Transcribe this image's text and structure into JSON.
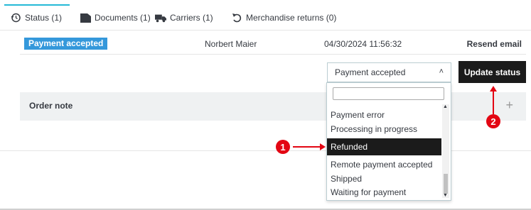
{
  "tabs": [
    {
      "label": "Status (1)",
      "icon": "history-icon",
      "active": true
    },
    {
      "label": "Documents (1)",
      "icon": "document-icon"
    },
    {
      "label": "Carriers (1)",
      "icon": "truck-icon"
    },
    {
      "label": "Merchandise returns (0)",
      "icon": "return-icon"
    }
  ],
  "history": {
    "status": "Payment accepted",
    "status_color": "#3498db",
    "employee": "Norbert Maier",
    "date": "04/30/2024 11:56:32",
    "resend": "Resend email"
  },
  "status_select": {
    "value": "Payment accepted",
    "options": [
      "Payment error",
      "Processing in progress",
      "Refunded",
      "Remote payment accepted",
      "Shipped",
      "Waiting for payment"
    ],
    "selected_option": "Refunded"
  },
  "update_button": "Update status",
  "order_note": {
    "title": "Order note",
    "add": "+"
  },
  "annotations": {
    "marker1": "1",
    "marker2": "2",
    "color": "#e30613"
  }
}
